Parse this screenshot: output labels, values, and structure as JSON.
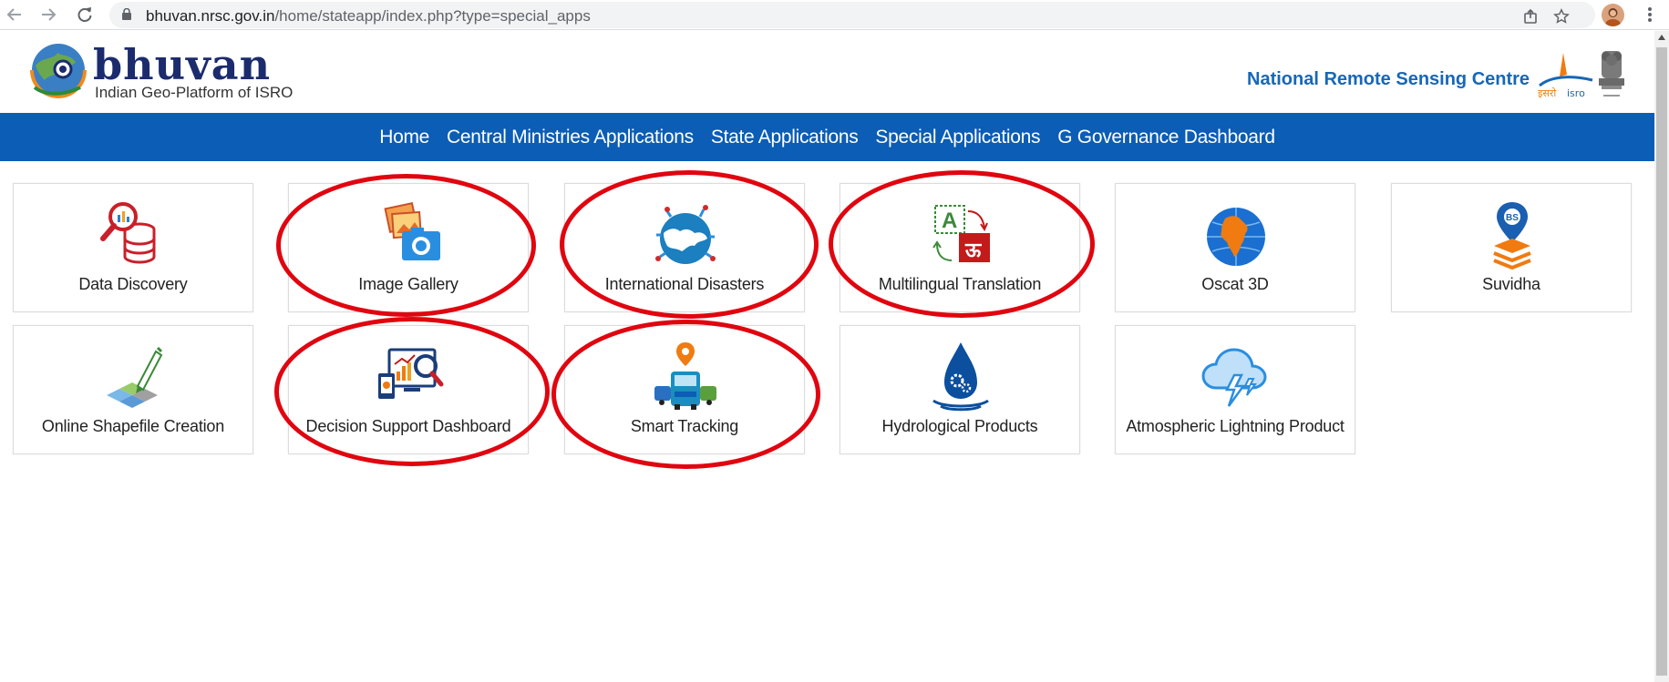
{
  "browser": {
    "url_host": "bhuvan.nrsc.gov.in",
    "url_path": "/home/stateapp/index.php?type=special_apps",
    "icons": [
      "back-arrow-icon",
      "forward-arrow-icon",
      "reload-icon",
      "lock-icon",
      "share-icon",
      "star-icon",
      "profile-avatar",
      "kebab-menu-icon"
    ]
  },
  "header": {
    "logo_word": "bhuvan",
    "logo_tagline": "Indian Geo-Platform of ISRO",
    "org_title": "National Remote Sensing Centre"
  },
  "nav": {
    "items": [
      {
        "label": "Home"
      },
      {
        "label": "Central Ministries Applications"
      },
      {
        "label": "State Applications"
      },
      {
        "label": "Special Applications"
      },
      {
        "label": "G Governance Dashboard"
      }
    ]
  },
  "tiles": [
    {
      "label": "Data Discovery",
      "icon": "data-discovery-icon",
      "highlighted": false
    },
    {
      "label": "Image Gallery",
      "icon": "image-gallery-icon",
      "highlighted": true
    },
    {
      "label": "International Disasters",
      "icon": "international-disasters-icon",
      "highlighted": true
    },
    {
      "label": "Multilingual Translation",
      "icon": "translation-icon",
      "highlighted": true
    },
    {
      "label": "Oscat 3D",
      "icon": "oscat-globe-icon",
      "highlighted": false
    },
    {
      "label": "Suvidha",
      "icon": "suvidha-pin-icon",
      "highlighted": false
    },
    {
      "label": "Online Shapefile Creation",
      "icon": "shapefile-pen-icon",
      "highlighted": false
    },
    {
      "label": "Decision Support Dashboard",
      "icon": "dashboard-magnifier-icon",
      "highlighted": true
    },
    {
      "label": "Smart Tracking",
      "icon": "truck-tracking-icon",
      "highlighted": true
    },
    {
      "label": "Hydrological Products",
      "icon": "water-drop-gear-icon",
      "highlighted": false
    },
    {
      "label": "Atmospheric Lightning Product",
      "icon": "cloud-lightning-icon",
      "highlighted": false
    }
  ],
  "colors": {
    "nav_bg": "#0b5db5",
    "annotation_red": "#e0050f",
    "nrsc_blue": "#1767b7"
  }
}
